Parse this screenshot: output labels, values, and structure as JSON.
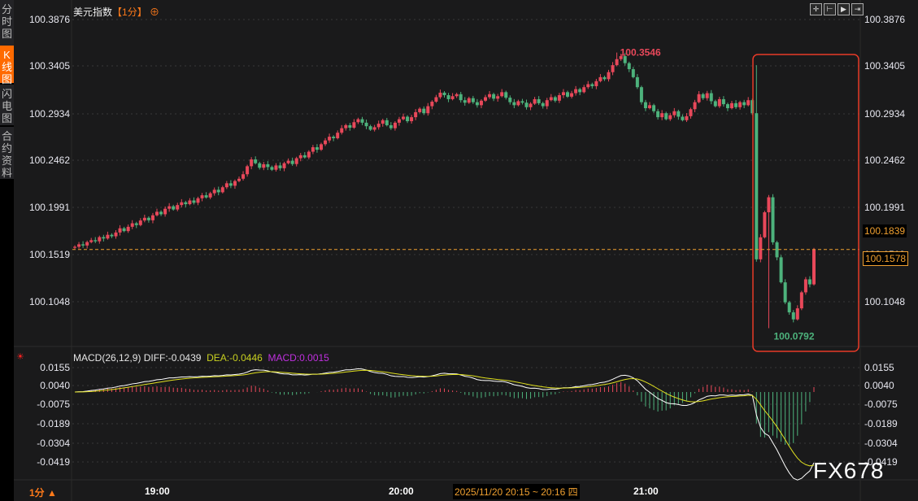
{
  "sidebar": {
    "tabs": [
      {
        "label": "分时图",
        "active": false
      },
      {
        "label": "K线图",
        "active": true
      },
      {
        "label": "闪电图",
        "active": false
      },
      {
        "label": "合约资料",
        "active": false
      }
    ]
  },
  "header": {
    "title": "美元指数",
    "period": "【1分】",
    "crosshair_icon": "⊕",
    "tools": [
      "crosshair-icon",
      "fit-left-icon",
      "play-icon",
      "fit-right-icon"
    ]
  },
  "main_axis": {
    "ticks": [
      "100.3876",
      "100.3405",
      "100.2934",
      "100.2462",
      "100.1991",
      "100.1519",
      "100.1048"
    ],
    "last_price": "100.1578",
    "mark_price": "100.1839",
    "high_label": "100.3546",
    "low_label": "100.0792"
  },
  "macd": {
    "title": "MACD(26,12,9)",
    "diff": "DIFF:-0.0439",
    "dea": "DEA:-0.0446",
    "macd": "MACD:0.0015",
    "ticks": [
      "0.0155",
      "0.0040",
      "-0.0075",
      "-0.0189",
      "-0.0304",
      "-0.0419"
    ],
    "ticks_right": [
      "0.0155",
      "0.0040",
      "-0.0075",
      "-0.0189",
      "-0.0304",
      "-0.0419"
    ]
  },
  "time_axis": {
    "labels": [
      "19:00",
      "20:00",
      "21:00"
    ],
    "cursor": "2025/11/20 20:15 ~ 20:16 四",
    "period": "1分 ▲"
  },
  "watermark": "FX678",
  "colors": {
    "up": "#e8485a",
    "down": "#4db27c",
    "diff": "#ffffff",
    "dea": "#e0e020",
    "accent": "#ff6a00",
    "highlight_box": "#e83a28"
  },
  "chart_data": {
    "type": "candlestick",
    "interval": "1 minute",
    "ylim": [
      100.0792,
      100.3876
    ],
    "closes": [
      100.1605,
      100.163,
      100.1618,
      100.1652,
      100.1671,
      100.166,
      100.1702,
      100.1688,
      100.1725,
      100.171,
      100.1748,
      100.179,
      100.1762,
      100.1805,
      100.184,
      100.1822,
      100.1868,
      100.1895,
      100.187,
      100.192,
      100.1955,
      100.193,
      100.1985,
      100.201,
      100.1978,
      100.2022,
      100.205,
      100.2031,
      100.2068,
      100.2045,
      100.209,
      100.212,
      100.2098,
      100.214,
      100.2175,
      100.215,
      100.22,
      100.224,
      100.2215,
      100.2262,
      100.2285,
      100.233,
      100.241,
      100.2478,
      100.244,
      100.2395,
      100.243,
      100.2402,
      100.2375,
      100.2418,
      100.239,
      100.244,
      100.2465,
      100.2432,
      100.249,
      100.252,
      100.2498,
      100.2555,
      100.26,
      100.2575,
      100.263,
      100.2668,
      100.2705,
      100.269,
      100.2745,
      100.279,
      100.282,
      100.2795,
      100.285,
      100.288,
      100.2845,
      100.281,
      100.2775,
      100.28,
      100.2835,
      100.287,
      100.282,
      100.279,
      100.2845,
      100.288,
      100.2905,
      100.286,
      100.29,
      100.295,
      100.2985,
      100.294,
      100.301,
      100.3055,
      100.31,
      100.3145,
      100.312,
      100.308,
      100.311,
      100.313,
      100.307,
      100.3045,
      100.309,
      100.305,
      100.302,
      100.3065,
      100.31,
      100.313,
      100.3085,
      100.311,
      100.315,
      100.3095,
      100.305,
      100.302,
      100.306,
      100.3045,
      100.3,
      100.3035,
      100.308,
      100.304,
      100.301,
      100.307,
      100.31,
      100.3065,
      100.312,
      100.315,
      100.3105,
      100.314,
      100.318,
      100.315,
      100.32,
      100.323,
      100.321,
      100.326,
      100.33,
      100.328,
      100.335,
      100.342,
      100.348,
      100.351,
      100.344,
      100.338,
      100.33,
      100.32,
      100.305,
      100.299,
      100.302,
      100.296,
      100.29,
      100.294,
      100.288,
      100.292,
      100.296,
      100.2905,
      100.287,
      100.291,
      100.298,
      100.305,
      100.313,
      100.309,
      100.314,
      100.306,
      100.301,
      100.308,
      100.303,
      100.299,
      100.304,
      100.3,
      100.305,
      100.302,
      100.307,
      100.294,
      100.148,
      100.17,
      100.195,
      100.21,
      100.165,
      100.15,
      100.125,
      100.105,
      100.095,
      100.088,
      100.099,
      100.115,
      100.128,
      100.123,
      100.158
    ]
  }
}
